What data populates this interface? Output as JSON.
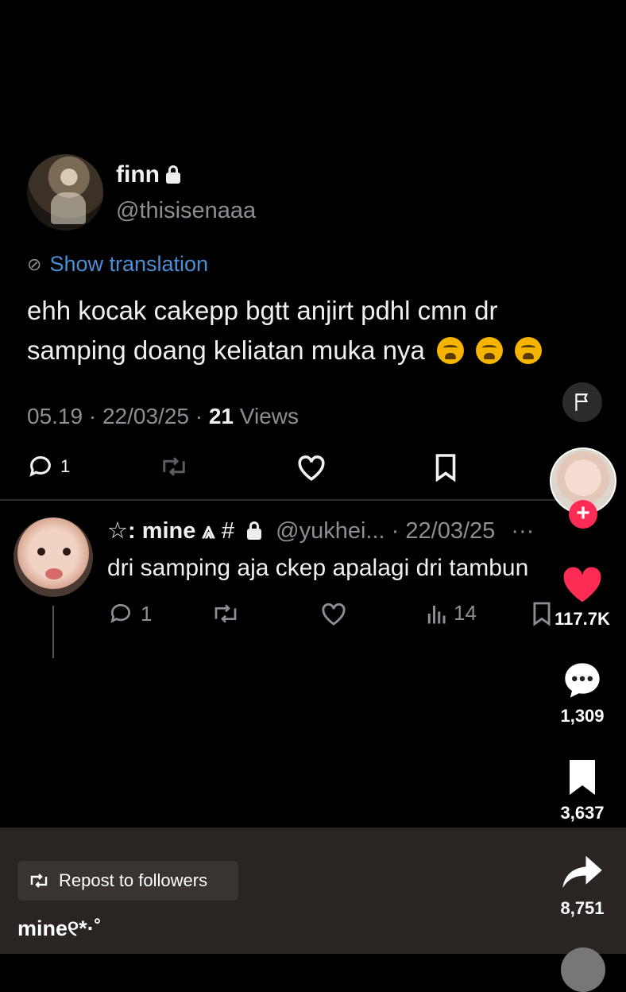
{
  "tweet": {
    "name": "finn",
    "handle": "@thisisenaaa",
    "show_translation": "Show translation",
    "text": "ehh kocak cakepp bgtt anjirt pdhl cmn dr samping doang keliatan muka nya",
    "emoji_count": 3,
    "time": "05.19",
    "date": "22/03/25",
    "views_count": "21",
    "views_label": "Views",
    "reply_count": "1"
  },
  "reply": {
    "name": "☆: mine",
    "name_suffix": "#",
    "handle": "@yukhei...",
    "date": "22/03/25",
    "text": "dri samping aja ckep apalagi dri tambun",
    "reply_count": "1",
    "views": "14"
  },
  "rail": {
    "likes": "117.7K",
    "comments": "1,309",
    "bookmarks": "3,637",
    "shares": "8,751",
    "follow_symbol": "+"
  },
  "bottom": {
    "repost_label": "Repost to followers",
    "caption": "mine୧*·˚"
  },
  "colors": {
    "background": "#000000",
    "link_blue": "#4a8fd6",
    "muted_gray": "#8b8f95",
    "like_red": "#fe2c55",
    "bottom_bar": "#2a2422"
  }
}
